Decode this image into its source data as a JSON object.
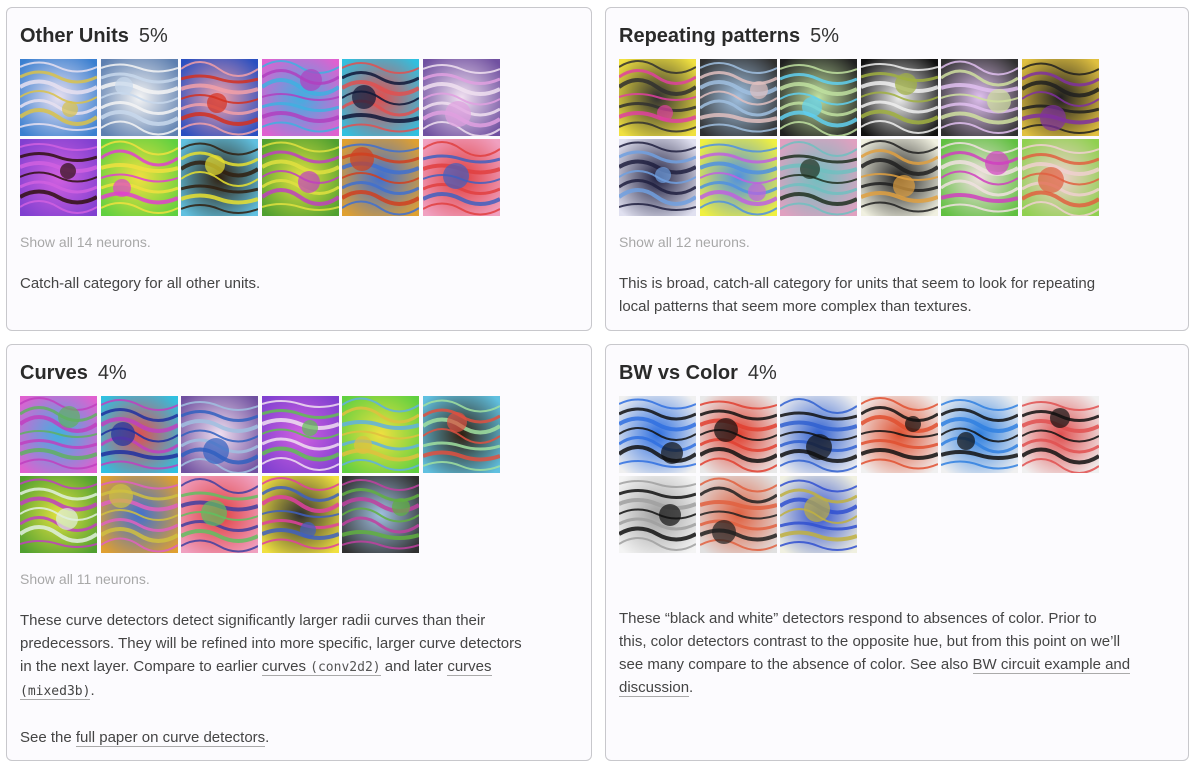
{
  "cards": {
    "other": {
      "title": "Other Units",
      "pct": "5%",
      "show_all": "Show all 14 neurons.",
      "desc": "Catch-all category for all other units."
    },
    "repeating": {
      "title": "Repeating patterns",
      "pct": "5%",
      "show_all": "Show all 12 neurons.",
      "desc_line1": "This is broad, catch-all category for units that seem to look for repeating",
      "desc_line2": "local patterns that seem more complex than textures."
    },
    "curves": {
      "title": "Curves",
      "pct": "4%",
      "show_all": "Show all 11 neurons.",
      "desc_l1": "These curve detectors detect significantly larger radii curves than their",
      "desc_l2": "predecessors. They will be refined into more specific, larger curve detectors",
      "desc_l3a": "in the next layer. Compare to earlier ",
      "link_curves1": "curves",
      "link_conv": "(conv2d2)",
      "desc_l3b": " and later ",
      "link_curves2": "curves",
      "link_mixed": "(mixed3b)",
      "desc_l4b": ".",
      "see_pre": "See the ",
      "see_link": "full paper on curve detectors",
      "see_post": "."
    },
    "bw": {
      "title": "BW vs Color",
      "pct": "4%",
      "desc_l1": "These “black and white” detectors respond to absences of color. Prior to",
      "desc_l2": "this, color detectors contrast to the opposite hue, but from this point on we’ll",
      "desc_l3a": "see many compare to the absence of color. See also ",
      "link_bw": "BW circuit example and",
      "link_disc": "discussion",
      "desc_l4b": "."
    }
  },
  "thumb_icons": {
    "other": [
      "neuron-0",
      "neuron-1",
      "neuron-2",
      "neuron-3",
      "neuron-4",
      "neuron-5",
      "neuron-6",
      "neuron-7",
      "neuron-8",
      "neuron-9",
      "neuron-10",
      "neuron-11"
    ],
    "repeating": [
      "neuron-0",
      "neuron-1",
      "neuron-2",
      "neuron-3",
      "neuron-4",
      "neuron-5",
      "neuron-6",
      "neuron-7",
      "neuron-8",
      "neuron-9",
      "neuron-10",
      "neuron-11"
    ],
    "curves": [
      "neuron-0",
      "neuron-1",
      "neuron-2",
      "neuron-3",
      "neuron-4",
      "neuron-5",
      "neuron-6",
      "neuron-7",
      "neuron-8",
      "neuron-9",
      "neuron-10"
    ],
    "bw": [
      "neuron-0",
      "neuron-1",
      "neuron-2",
      "neuron-3",
      "neuron-4",
      "neuron-5",
      "neuron-6",
      "neuron-7",
      "neuron-8"
    ]
  },
  "colors": {
    "card_bg": "#fcfbfe",
    "card_border": "#c8c8cc",
    "muted_text": "#a8a8a8",
    "body_text": "#444444"
  }
}
